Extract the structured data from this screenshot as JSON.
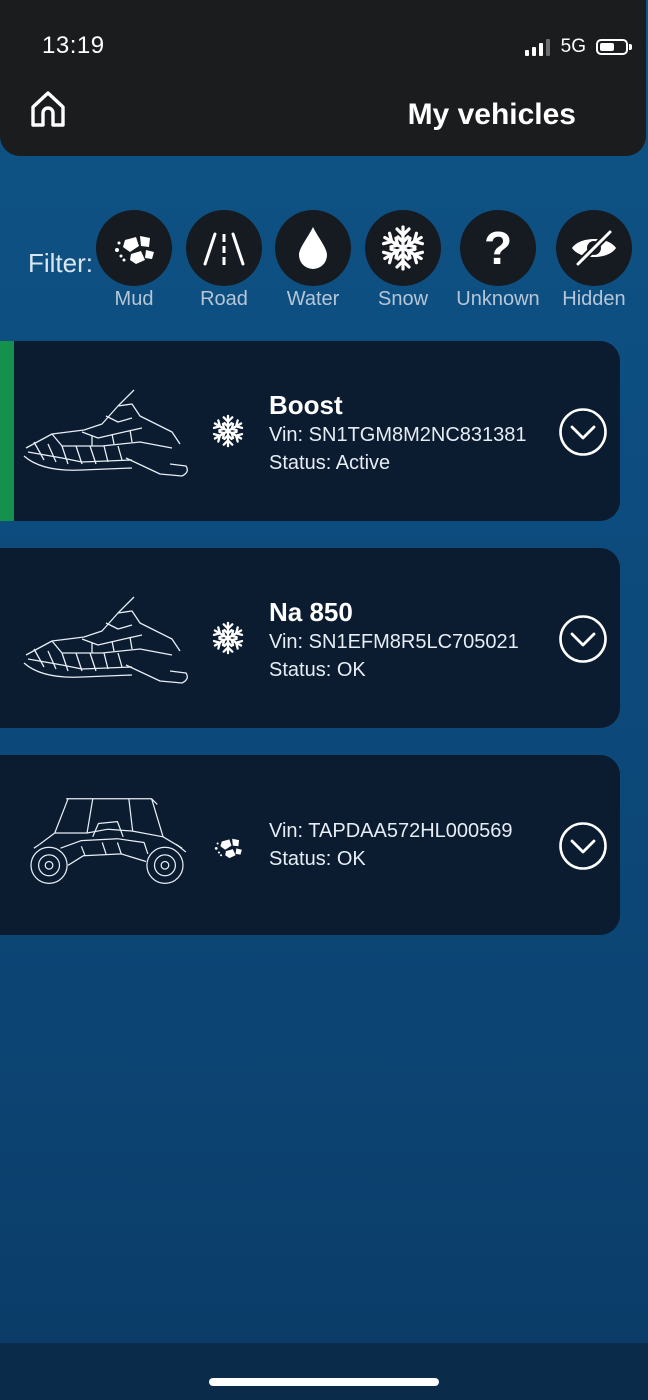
{
  "status_bar": {
    "time": "13:19",
    "network": "5G",
    "battery_level": 0.6
  },
  "header": {
    "title": "My vehicles",
    "home_icon": "home-icon"
  },
  "filter": {
    "label": "Filter:",
    "items": [
      {
        "label": "Mud",
        "icon": "mud-icon"
      },
      {
        "label": "Road",
        "icon": "road-icon"
      },
      {
        "label": "Water",
        "icon": "water-drop-icon"
      },
      {
        "label": "Snow",
        "icon": "snowflake-icon"
      },
      {
        "label": "Unknown",
        "icon": "question-mark-icon",
        "glyph": "?"
      },
      {
        "label": "Hidden",
        "icon": "eye-slash-icon"
      }
    ]
  },
  "vehicles": [
    {
      "name": "Boost",
      "vin": "Vin: SN1TGM8M2NC831381",
      "status": "Status: Active",
      "terrain_icon": "snowflake-icon",
      "image": "snowmobile-image",
      "active": true
    },
    {
      "name": "Na 850",
      "vin": "Vin: SN1EFM8R5LC705021",
      "status": "Status: OK",
      "terrain_icon": "snowflake-icon",
      "image": "snowmobile-image",
      "active": false
    },
    {
      "name": "",
      "vin": "Vin: TAPDAA572HL000569",
      "status": "Status: OK",
      "terrain_icon": "mud-icon",
      "image": "side-by-side-utv-image",
      "active": false
    }
  ],
  "colors": {
    "active_indicator": "#14924d",
    "card_background": "#0b1b30",
    "header_background": "#1b1c1e"
  }
}
